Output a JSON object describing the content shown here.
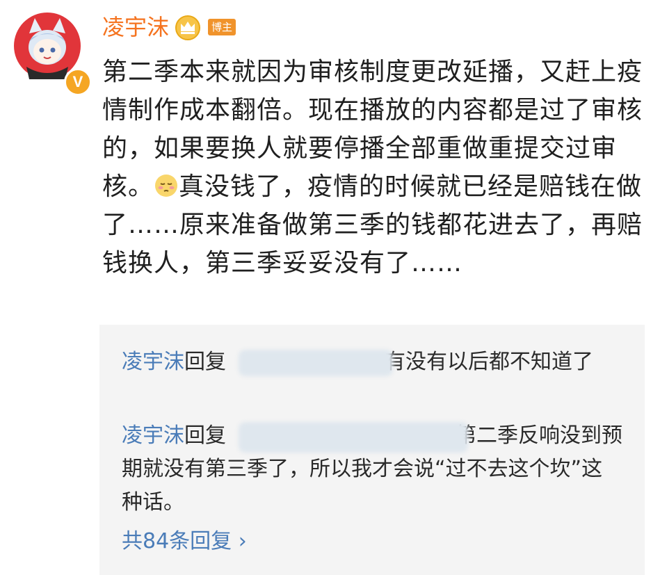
{
  "post": {
    "username": "凌宇沫",
    "author_tag": "博主",
    "text_before_emoji": "第二季本来就因为审核制度更改延播，又赶上疫情制作成本翻倍。现在播放的内容都是过了审核的，如果要换人就要停播全部重做重提交过审核。",
    "emoji": "blushing-face",
    "text_after_emoji": "真没钱了，疫情的时候就已经是赔钱在做了……原来准备做第三季的钱都花进去了，再赔钱换人，第三季妥妥没有了……"
  },
  "replies": [
    {
      "user": "凌宇沫",
      "verb": "回复",
      "text": "有没有以后都不知道了"
    },
    {
      "user": "凌宇沫",
      "verb": "回复",
      "text": "第二季反响没到预期就没有第三季了，所以我才会说“过不去这个坎”这种话。"
    }
  ],
  "more_replies": "共84条回复 ›",
  "colors": {
    "username": "#f5731f",
    "reply_user": "#4a7cb8",
    "tag": "#f0932b",
    "reply_bg": "#f4f4f4"
  }
}
